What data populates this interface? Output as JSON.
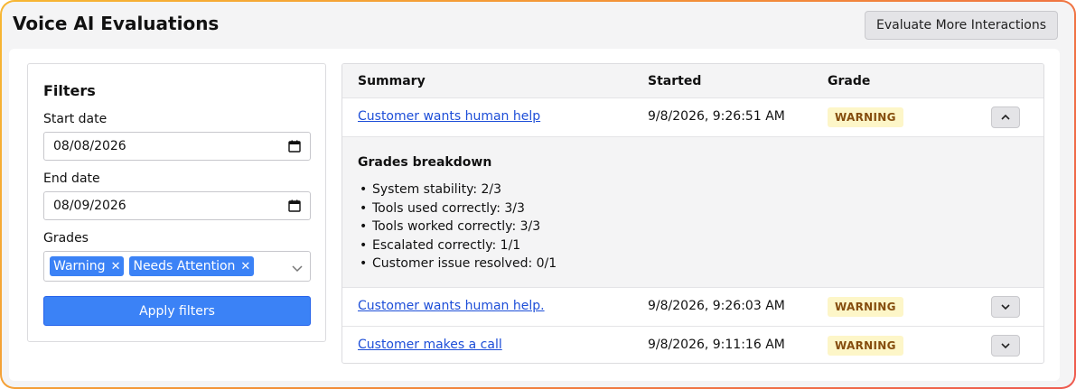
{
  "header": {
    "title": "Voice AI Evaluations",
    "evaluate_button": "Evaluate More Interactions"
  },
  "filters": {
    "title": "Filters",
    "start_date_label": "Start date",
    "start_date_value": "08/08/2026",
    "end_date_label": "End date",
    "end_date_value": "08/09/2026",
    "grades_label": "Grades",
    "selected_grades": [
      "Warning",
      "Needs Attention"
    ],
    "apply_button": "Apply filters"
  },
  "table": {
    "columns": [
      "Summary",
      "Started",
      "Grade"
    ],
    "rows": [
      {
        "summary": "Customer wants human help",
        "started": "9/8/2026, 9:26:51 AM",
        "grade": "WARNING",
        "expanded": true
      },
      {
        "summary": "Customer wants human help.",
        "started": "9/8/2026, 9:26:03 AM",
        "grade": "WARNING",
        "expanded": false
      },
      {
        "summary": "Customer makes a call",
        "started": "9/8/2026, 9:11:16 AM",
        "grade": "WARNING",
        "expanded": false
      }
    ],
    "breakdown": {
      "title": "Grades breakdown",
      "items": [
        "System stability: 2/3",
        "Tools used correctly: 3/3",
        "Tools worked correctly: 3/3",
        "Escalated correctly: 1/1",
        "Customer issue resolved: 0/1"
      ]
    }
  },
  "colors": {
    "accent": "#3b82f6",
    "warning_bg": "#fdf6c8",
    "warning_text": "#854d0e",
    "link": "#1d4ed8"
  },
  "icons": {
    "calendar": "calendar-icon",
    "chip_remove": "close-icon",
    "dropdown": "chevron-down-icon",
    "collapse": "chevron-up-icon",
    "expand": "chevron-down-icon"
  }
}
